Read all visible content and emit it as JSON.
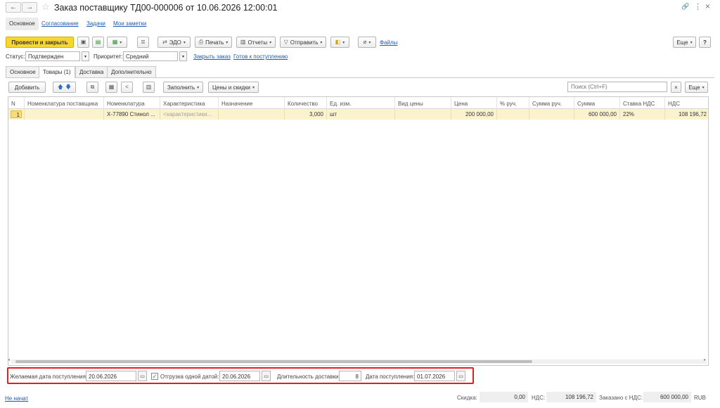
{
  "titlebar": {
    "back": "←",
    "forward": "→",
    "star": "☆",
    "title": "Заказ поставщику ТД00-000006 от 10.06.2026 12:00:01",
    "link_icon": "🔗",
    "more_icon": "⋮",
    "close_icon": "×"
  },
  "top_tabs": [
    "Основное",
    "Согласование",
    "Задачи",
    "Мои заметки"
  ],
  "toolbar": {
    "post_close": "Провести и закрыть",
    "edo": "ЭДО",
    "print": "Печать",
    "reports": "Отчеты",
    "send": "Отправить",
    "files": "Файлы",
    "more": "Еще",
    "help": "?"
  },
  "status": {
    "status_label": "Статус:",
    "status_value": "Подтвержден",
    "priority_label": "Приоритет:",
    "priority_value": "Средний",
    "close_order": "Закрыть заказ",
    "ready": "Готов к поступлению"
  },
  "inner_tabs": [
    "Основное",
    "Товары (1)",
    "Доставка",
    "Дополнительно"
  ],
  "table_toolbar": {
    "add": "Добавить",
    "fill": "Заполнить",
    "prices": "Цены и скидки",
    "search_placeholder": "Поиск (Ctrl+F)",
    "clear": "×",
    "more": "Еще"
  },
  "table": {
    "headers": [
      "N",
      "Номенклатура поставщика",
      "Номенклатура",
      "Характеристика",
      "Назначение",
      "Количество",
      "Ед. изм.",
      "Вид цены",
      "Цена",
      "% руч.",
      "Сумма руч.",
      "Сумма",
      "Ставка НДС",
      "НДС"
    ],
    "rows": [
      [
        "1",
        "",
        "X-77890 Стинол ...",
        "<характеристики...",
        "",
        "3,000",
        "шт",
        "",
        "200 000,00",
        "",
        "",
        "600 000,00",
        "22%",
        "108 196,72"
      ]
    ]
  },
  "bottom": {
    "desired_date_label": "Желаемая дата поступления:",
    "desired_date": "20.06.2026",
    "one_date_checked": true,
    "one_date_label": "Отгрузка одной датой:",
    "one_date_value": "20.06.2026",
    "duration_label": "Длительность доставки:",
    "duration_value": "8",
    "arrival_label": "Дата поступления:",
    "arrival_value": "01.07.2026"
  },
  "statusbar": {
    "not_started": "Не начат",
    "discount_label": "Скидка:",
    "discount_value": "0,00",
    "vat_label": "НДС:",
    "vat_value": "108 196,72",
    "ordered_label": "Заказано с НДС:",
    "ordered_value": "600 000,00",
    "currency": "RUB"
  },
  "colors": {
    "primary_button": "#f6d634",
    "highlight_row": "#fbf3cf",
    "callout_border": "#e01f1f",
    "link": "#1e5bb8"
  }
}
